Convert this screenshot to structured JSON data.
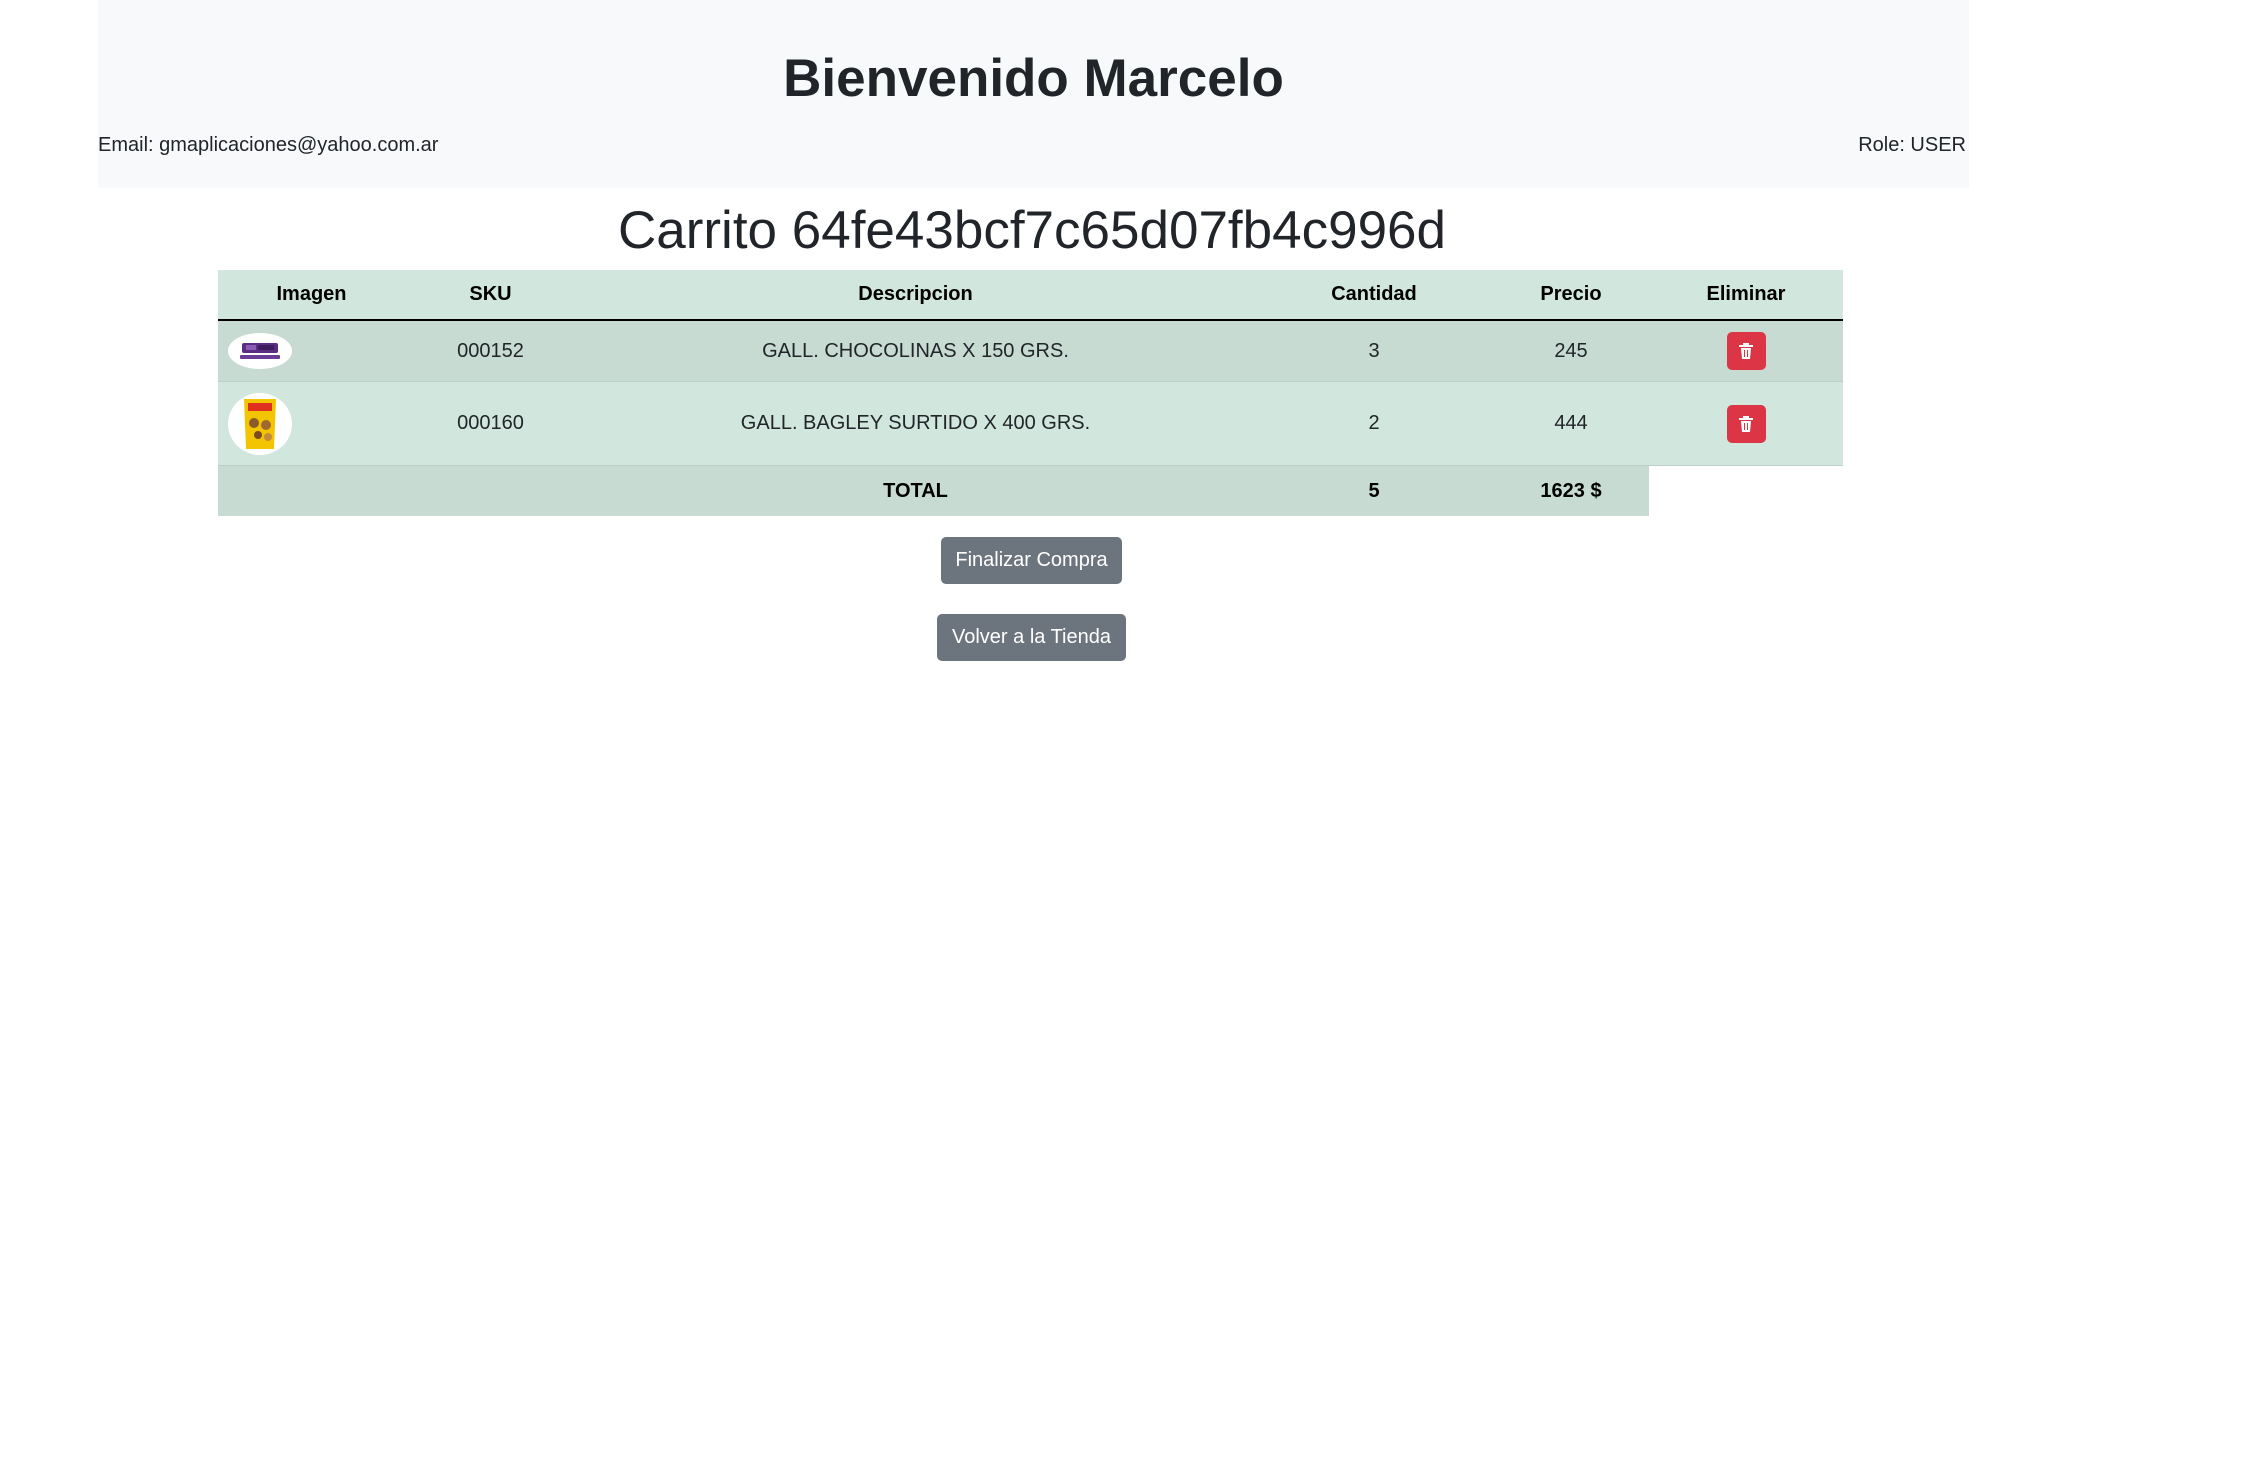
{
  "header": {
    "welcome": "Bienvenido Marcelo",
    "email": "Email: gmaplicaciones@yahoo.com.ar",
    "role": "Role: USER"
  },
  "cart": {
    "title": "Carrito 64fe43bcf7c65d07fb4c996d",
    "columns": [
      "Imagen",
      "SKU",
      "Descripcion",
      "Cantidad",
      "Precio",
      "Eliminar"
    ],
    "items": [
      {
        "sku": "000152",
        "description": "GALL. CHOCOLINAS X 150 GRS.",
        "quantity": "3",
        "price": "245",
        "image_icon": "chocolinas-product-image"
      },
      {
        "sku": "000160",
        "description": "GALL. BAGLEY SURTIDO X 400 GRS.",
        "quantity": "2",
        "price": "444",
        "image_icon": "bagley-surtido-product-image"
      }
    ],
    "total": {
      "label": "TOTAL",
      "quantity": "5",
      "price": "1623 $"
    },
    "delete_icon": "trash-icon"
  },
  "actions": {
    "finish_label": "Finalizar Compra",
    "back_label": "Volver a la Tienda"
  },
  "colors": {
    "header_bg": "#f8f9fa",
    "table_bg": "#d1e7dd",
    "table_striped_bg": "#c7dbd2",
    "danger": "#dc3545",
    "secondary": "#6c757d"
  }
}
